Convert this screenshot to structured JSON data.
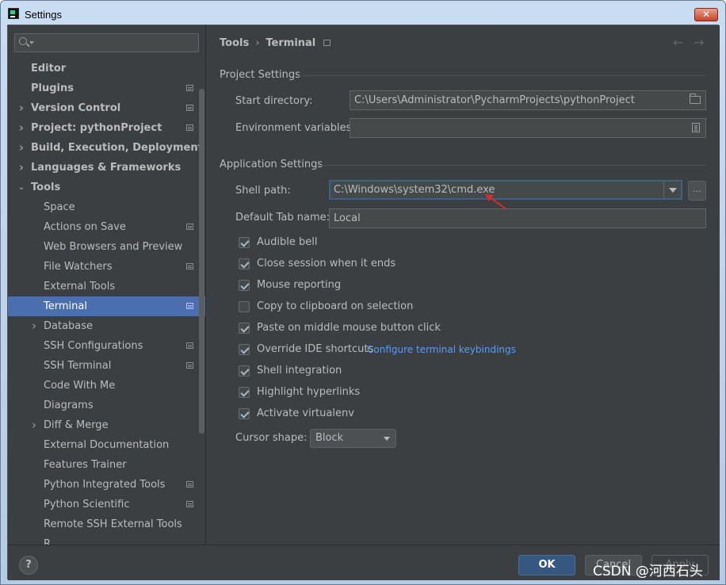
{
  "window": {
    "title": "Settings",
    "close_label": "✕"
  },
  "sidebar": {
    "items": [
      {
        "label": "Editor",
        "top": true
      },
      {
        "label": "Plugins",
        "top": true,
        "doc": true
      },
      {
        "label": "Version Control",
        "top": true,
        "arrow": "right",
        "doc": true
      },
      {
        "label": "Project: pythonProject",
        "top": true,
        "arrow": "right",
        "doc": true
      },
      {
        "label": "Build, Execution, Deployment",
        "top": true,
        "arrow": "right"
      },
      {
        "label": "Languages & Frameworks",
        "top": true,
        "arrow": "right"
      },
      {
        "label": "Tools",
        "top": true,
        "arrow": "down"
      },
      {
        "label": "Space"
      },
      {
        "label": "Actions on Save",
        "doc": true
      },
      {
        "label": "Web Browsers and Preview"
      },
      {
        "label": "File Watchers",
        "doc": true
      },
      {
        "label": "External Tools"
      },
      {
        "label": "Terminal",
        "doc": true,
        "selected": true
      },
      {
        "label": "Database",
        "arrow": "right"
      },
      {
        "label": "SSH Configurations",
        "doc": true
      },
      {
        "label": "SSH Terminal",
        "doc": true
      },
      {
        "label": "Code With Me"
      },
      {
        "label": "Diagrams"
      },
      {
        "label": "Diff & Merge",
        "arrow": "right"
      },
      {
        "label": "External Documentation"
      },
      {
        "label": "Features Trainer"
      },
      {
        "label": "Python Integrated Tools",
        "doc": true
      },
      {
        "label": "Python Scientific",
        "doc": true
      },
      {
        "label": "Remote SSH External Tools"
      },
      {
        "label": "R..."
      }
    ]
  },
  "breadcrumb": {
    "parent": "Tools",
    "separator": "›",
    "current": "Terminal"
  },
  "nav": {
    "back": "←",
    "forward": "→"
  },
  "project_settings": {
    "title": "Project Settings",
    "start_directory_label": "Start directory:",
    "start_directory_value": "C:\\Users\\Administrator\\PycharmProjects\\pythonProject",
    "env_vars_label": "Environment variables:",
    "env_vars_value": ""
  },
  "app_settings": {
    "title": "Application Settings",
    "shell_path_label": "Shell path:",
    "shell_path_value": "C:\\Windows\\system32\\cmd.exe",
    "browse_label": "...",
    "tab_name_label": "Default Tab name:",
    "tab_name_value": "Local",
    "checkboxes": [
      {
        "label": "Audible bell",
        "checked": true
      },
      {
        "label": "Close session when it ends",
        "checked": true
      },
      {
        "label": "Mouse reporting",
        "checked": true
      },
      {
        "label": "Copy to clipboard on selection",
        "checked": false
      },
      {
        "label": "Paste on middle mouse button click",
        "checked": true
      },
      {
        "label": "Override IDE shortcuts",
        "checked": true
      },
      {
        "label": "Shell integration",
        "checked": true
      },
      {
        "label": "Highlight hyperlinks",
        "checked": true
      },
      {
        "label": "Activate virtualenv",
        "checked": true
      }
    ],
    "keybindings_link": "Configure terminal keybindings",
    "cursor_shape_label": "Cursor shape:",
    "cursor_shape_value": "Block"
  },
  "footer": {
    "help": "?",
    "ok": "OK",
    "cancel": "Cancel",
    "apply": "Apply"
  },
  "watermark": "CSDN @河西石头",
  "colors": {
    "accent": "#4b6eaf",
    "panel": "#3c3f41",
    "link": "#589df6",
    "annotation": "#d92b2b"
  }
}
